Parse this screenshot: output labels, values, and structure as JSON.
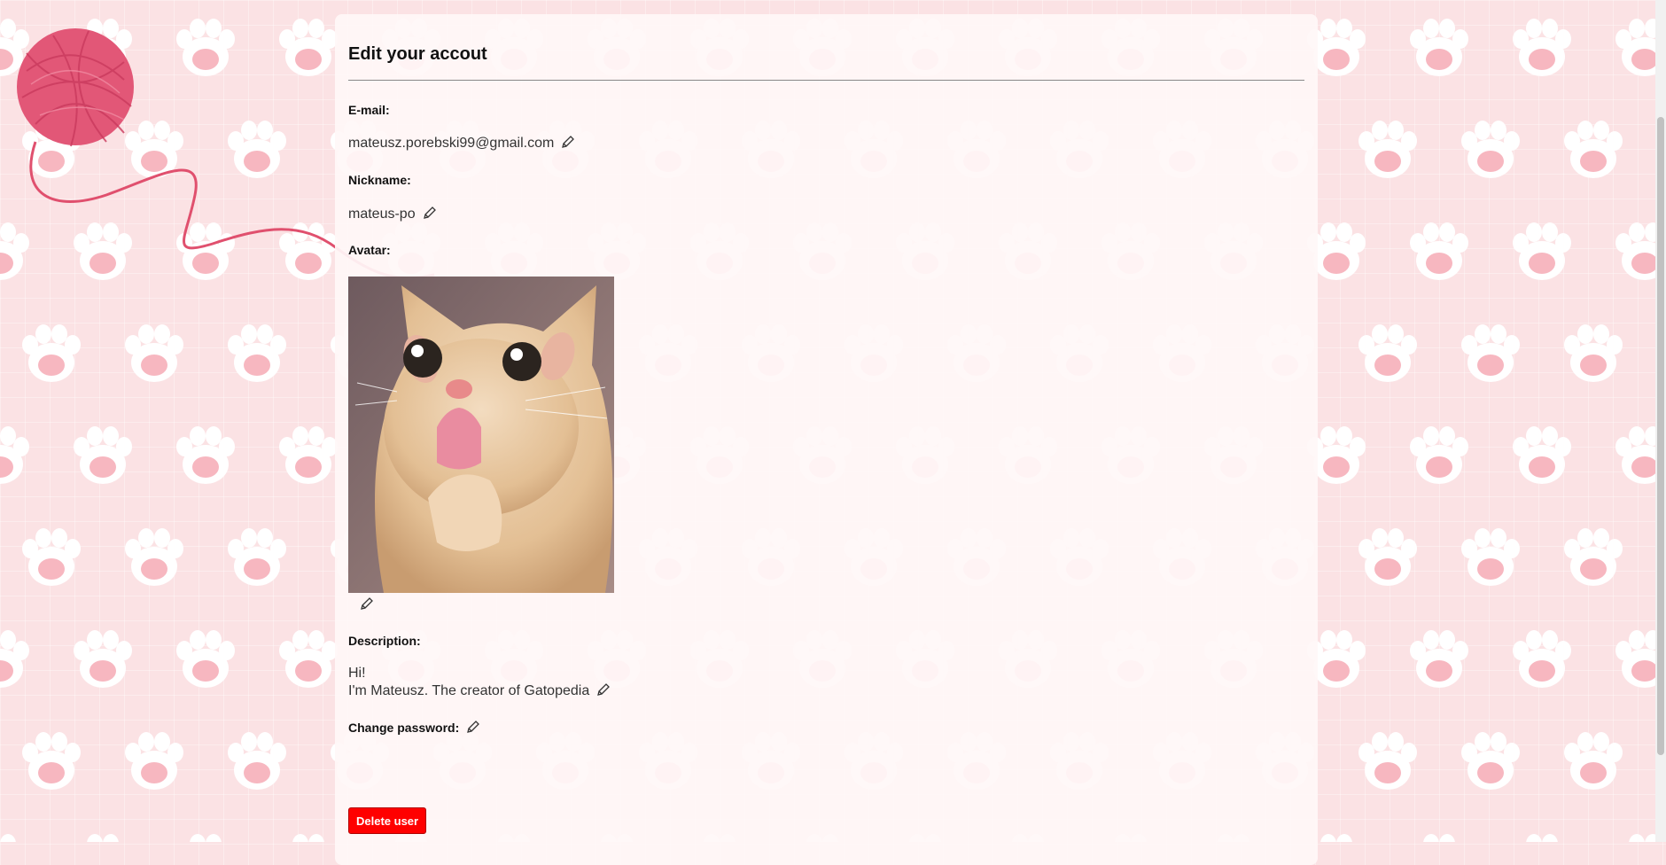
{
  "page": {
    "title": "Edit your accout",
    "background_color": "#fbe2e4"
  },
  "fields": {
    "email": {
      "label": "E-mail:",
      "value": "mateusz.porebski99@gmail.com"
    },
    "nickname": {
      "label": "Nickname:",
      "value": "mateus-po"
    },
    "avatar": {
      "label": "Avatar:",
      "image": "cat-licking-paw-photo"
    },
    "description": {
      "label": "Description:",
      "line1": "Hi!",
      "line2": "I'm Mateusz. The creator of Gatopedia"
    },
    "password": {
      "label": "Change password:"
    }
  },
  "actions": {
    "delete_label": "Delete user",
    "delete_color": "#ff0000"
  },
  "icons": {
    "edit": "pencil-icon",
    "decoration": "yarn-ball-icon",
    "pattern": "paw-print-icon"
  }
}
